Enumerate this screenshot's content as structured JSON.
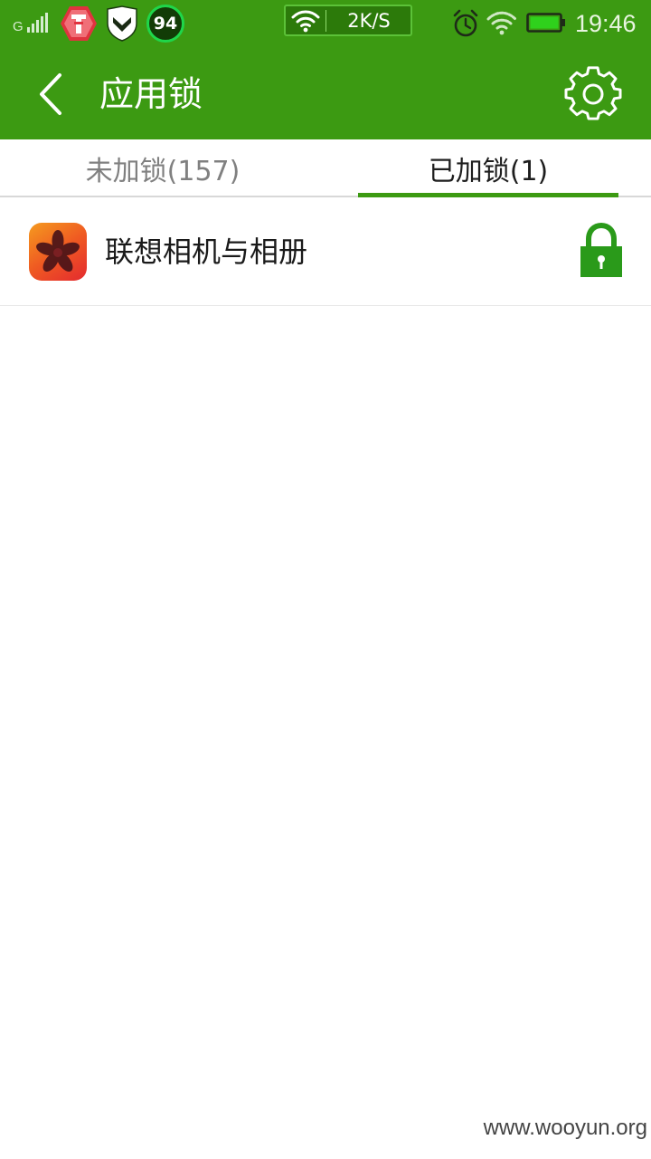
{
  "status_bar": {
    "network_type": "G",
    "battery_app_badge": "94",
    "net_speed": "2K/S",
    "time": "19:46",
    "icons": [
      "signal-icon",
      "app-notification-icon",
      "shield-app-icon",
      "battery-saver-icon",
      "wifi-icon",
      "alarm-icon",
      "wifi-icon",
      "battery-icon"
    ]
  },
  "header": {
    "title": "应用锁",
    "icons": [
      "back-arrow-icon",
      "gear-icon"
    ]
  },
  "tabs": [
    {
      "label": "未加锁(157)",
      "selected": false
    },
    {
      "label": "已加锁(1)",
      "selected": true
    }
  ],
  "locked_apps": [
    {
      "name": "联想相机与相册",
      "icon": "camera-gallery-app-icon",
      "locked": true,
      "lock_icon": "padlock-icon"
    }
  ],
  "watermark": "www.wooyun.org",
  "colors": {
    "accent": "#3c9a12",
    "status_bar": "#3c9a12",
    "tab_selected_text": "#1e1e1e",
    "tab_unselected_text": "#808080"
  }
}
